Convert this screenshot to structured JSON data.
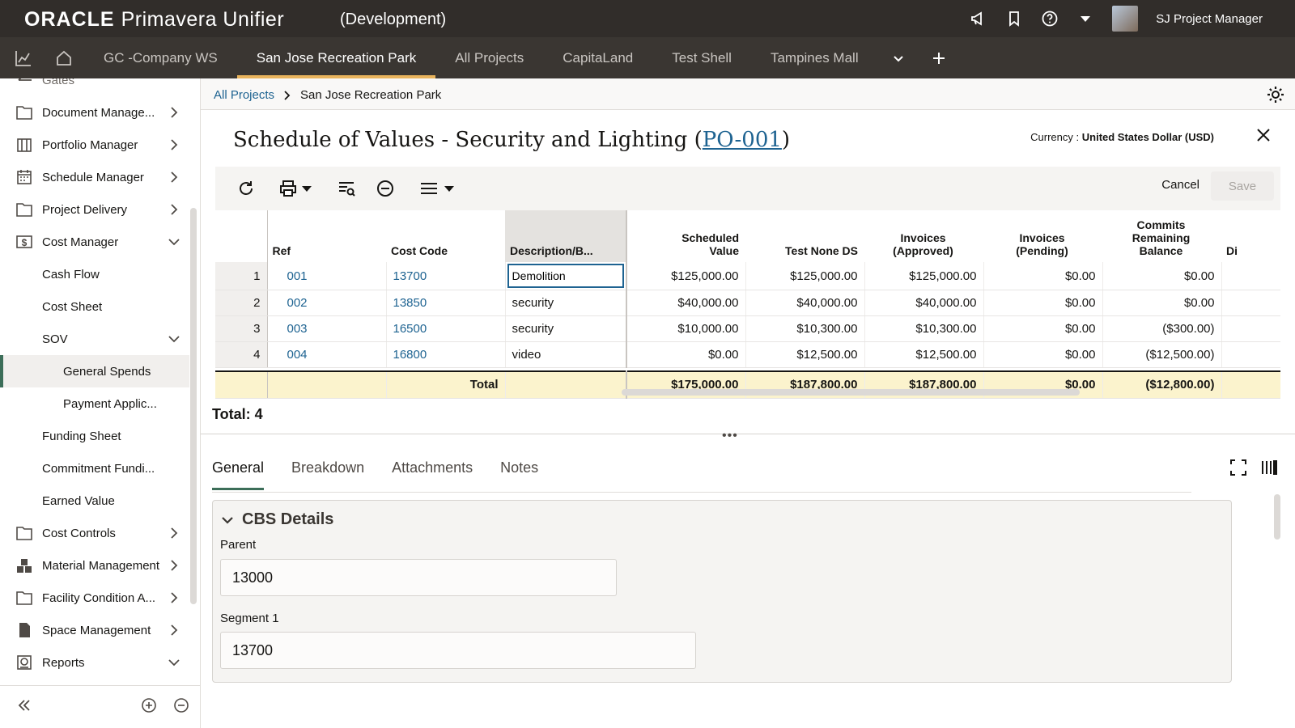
{
  "header": {
    "logo_oracle": "ORACLE",
    "logo_product": "Primavera Unifier",
    "environment": "(Development)",
    "user_name": "SJ Project Manager"
  },
  "tabs": [
    {
      "label": "GC -Company WS"
    },
    {
      "label": "San Jose Recreation Park"
    },
    {
      "label": "All Projects"
    },
    {
      "label": "CapitaLand"
    },
    {
      "label": "Test Shell"
    },
    {
      "label": "Tampines Mall"
    }
  ],
  "sidebar": {
    "items": [
      {
        "label": "Gates"
      },
      {
        "label": "Document Manage..."
      },
      {
        "label": "Portfolio Manager"
      },
      {
        "label": "Schedule Manager"
      },
      {
        "label": "Project Delivery"
      },
      {
        "label": "Cost Manager"
      },
      {
        "label": "Cash Flow"
      },
      {
        "label": "Cost Sheet"
      },
      {
        "label": "SOV"
      },
      {
        "label": "General Spends"
      },
      {
        "label": "Payment Applic..."
      },
      {
        "label": "Funding Sheet"
      },
      {
        "label": "Commitment Fundi..."
      },
      {
        "label": "Earned Value"
      },
      {
        "label": "Cost Controls"
      },
      {
        "label": "Material Management"
      },
      {
        "label": "Facility Condition A..."
      },
      {
        "label": "Space Management"
      },
      {
        "label": "Reports"
      }
    ]
  },
  "breadcrumb": {
    "root": "All Projects",
    "current": "San Jose Recreation Park"
  },
  "document": {
    "title_prefix": "Schedule of Values - Security and Lighting (",
    "po_number": "PO-001",
    "title_suffix": ")",
    "currency_label": "Currency :",
    "currency_value": "United States Dollar (USD)"
  },
  "toolbar": {
    "cancel_label": "Cancel",
    "save_label": "Save"
  },
  "grid": {
    "headers": {
      "ref": "Ref",
      "cost_code": "Cost Code",
      "description": "Description/B...",
      "scheduled_value_1": "Scheduled",
      "scheduled_value_2": "Value",
      "test_none": "Test None DS",
      "inv_approved_1": "Invoices",
      "inv_approved_2": "(Approved)",
      "inv_pending_1": "Invoices",
      "inv_pending_2": "(Pending)",
      "commits_1": "Commits",
      "commits_2": "Remaining",
      "commits_3": "Balance",
      "next": "Di"
    },
    "rows": [
      {
        "num": "1",
        "ref": "001",
        "cost_code": "13700",
        "description": "Demolition",
        "scheduled": "$125,000.00",
        "test_none": "$125,000.00",
        "approved": "$125,000.00",
        "pending": "$0.00",
        "commits": "$0.00"
      },
      {
        "num": "2",
        "ref": "002",
        "cost_code": "13850",
        "description": "security",
        "scheduled": "$40,000.00",
        "test_none": "$40,000.00",
        "approved": "$40,000.00",
        "pending": "$0.00",
        "commits": "$0.00"
      },
      {
        "num": "3",
        "ref": "003",
        "cost_code": "16500",
        "description": "security",
        "scheduled": "$10,000.00",
        "test_none": "$10,300.00",
        "approved": "$10,300.00",
        "pending": "$0.00",
        "commits": "($300.00)"
      },
      {
        "num": "4",
        "ref": "004",
        "cost_code": "16800",
        "description": "video",
        "scheduled": "$0.00",
        "test_none": "$12,500.00",
        "approved": "$12,500.00",
        "pending": "$0.00",
        "commits": "($12,500.00)"
      }
    ],
    "total": {
      "label": "Total",
      "scheduled": "$175,000.00",
      "test_none": "$187,800.00",
      "approved": "$187,800.00",
      "pending": "$0.00",
      "commits": "($12,800.00)"
    },
    "count_label": "Total: 4"
  },
  "detail": {
    "tabs": [
      {
        "label": "General"
      },
      {
        "label": "Breakdown"
      },
      {
        "label": "Attachments"
      },
      {
        "label": "Notes"
      }
    ],
    "section_title": "CBS Details",
    "fields": [
      {
        "label": "Parent",
        "value": "13000"
      },
      {
        "label": "Segment 1",
        "value": "13700"
      }
    ]
  },
  "colors": {
    "topbar": "#312d2a",
    "tabbar": "#3a3632",
    "active_tab_underline": "#e8b35c",
    "link": "#1e6391",
    "total_row": "#fbf3cd",
    "accent_green": "#3c6e59"
  }
}
